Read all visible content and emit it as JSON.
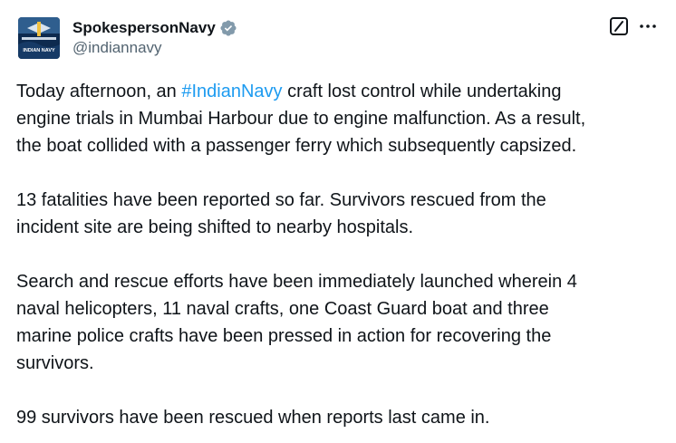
{
  "author": {
    "display_name": "SpokespersonNavy",
    "handle": "@indiannavy",
    "verified_color": "#829aab",
    "avatar_label": "INDIAN NAVY"
  },
  "tweet": {
    "p1_before": "Today afternoon, an ",
    "hashtag": "#IndianNavy",
    "p1_line1_after": " craft lost control while undertaking",
    "p1_line2": "engine trials in Mumbai Harbour due to engine malfunction. As a result,",
    "p1_line3": "the boat collided with a passenger ferry which subsequently capsized.",
    "p2_line1": "13 fatalities have been reported so far. Survivors rescued from the",
    "p2_line2": "incident site are being shifted to nearby hospitals.",
    "p3_line1": "Search and rescue efforts have been immediately launched wherein 4",
    "p3_line2": "naval helicopters, 11 naval crafts, one Coast Guard boat and three",
    "p3_line3": "marine police crafts have been pressed in action for recovering the",
    "p3_line4": "survivors.",
    "p4_line1": "99 survivors have been rescued when reports last came in."
  },
  "colors": {
    "text": "#0f1419",
    "secondary": "#536471",
    "link": "#1d9bf0"
  },
  "icons": {
    "grok": "grok-icon",
    "more": "more-icon",
    "verified": "verified-badge-icon"
  }
}
